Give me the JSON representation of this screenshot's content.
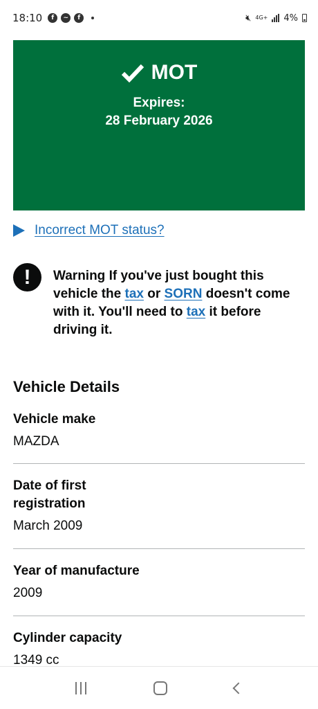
{
  "status_bar": {
    "time": "18:10",
    "network": "4G+",
    "battery": "4%"
  },
  "mot": {
    "title": "MOT",
    "expires_label": "Expires:",
    "expires_date": "28 February 2026",
    "color": "#00703c"
  },
  "details_toggle": {
    "label": "Incorrect MOT status?"
  },
  "warning": {
    "icon": "!",
    "prefix": "Warning If you've just bought this vehicle the ",
    "link1": "tax",
    "mid1": " or ",
    "link2": "SORN",
    "mid2": " doesn't come with it. You'll need to ",
    "link3": "tax",
    "suffix": " it before driving it."
  },
  "vehicle_details": {
    "title": "Vehicle Details",
    "rows": [
      {
        "key": "Vehicle make",
        "value": "MAZDA"
      },
      {
        "key": "Date of first registration",
        "value": "March 2009"
      },
      {
        "key": "Year of manufacture",
        "value": "2009"
      },
      {
        "key": "Cylinder capacity",
        "value": "1349 cc"
      }
    ]
  },
  "colors": {
    "link": "#1d70b8",
    "text": "#0b0c0c",
    "divider": "#b1b4b6"
  }
}
